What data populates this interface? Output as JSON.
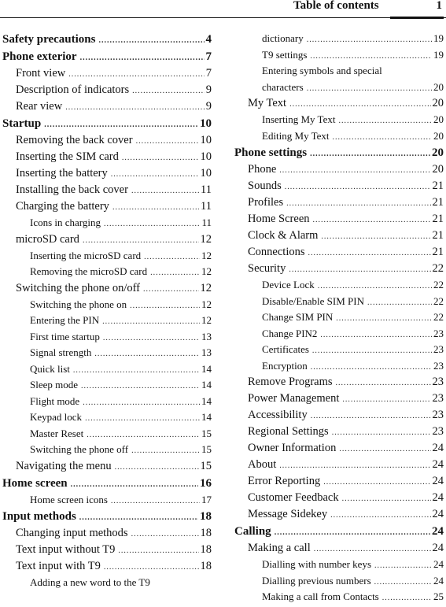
{
  "header": {
    "title": "Table of contents",
    "page": "1"
  },
  "left_column": [
    {
      "level": 1,
      "title": "Safety precautions",
      "page": "4"
    },
    {
      "level": 1,
      "title": "Phone exterior",
      "page": "7"
    },
    {
      "level": 2,
      "title": "Front view",
      "page": "7"
    },
    {
      "level": 2,
      "title": "Description of indicators",
      "page": "9"
    },
    {
      "level": 2,
      "title": "Rear view",
      "page": "9"
    },
    {
      "level": 1,
      "title": "Startup",
      "page": "10"
    },
    {
      "level": 2,
      "title": "Removing the back cover",
      "page": "10"
    },
    {
      "level": 2,
      "title": "Inserting the SIM card",
      "page": "10"
    },
    {
      "level": 2,
      "title": "Inserting the battery",
      "page": "10"
    },
    {
      "level": 2,
      "title": "Installing the back cover",
      "page": "11"
    },
    {
      "level": 2,
      "title": "Charging the battery",
      "page": "11"
    },
    {
      "level": 3,
      "title": "Icons in charging",
      "page": "11"
    },
    {
      "level": 2,
      "title": "microSD card",
      "page": "12"
    },
    {
      "level": 3,
      "title": "Inserting the microSD card",
      "page": "12"
    },
    {
      "level": 3,
      "title": "Removing the microSD card",
      "page": "12"
    },
    {
      "level": 2,
      "title": "Switching the phone on/off",
      "page": "12"
    },
    {
      "level": 3,
      "title": "Switching the phone on",
      "page": "12"
    },
    {
      "level": 3,
      "title": "Entering the PIN",
      "page": "12"
    },
    {
      "level": 3,
      "title": "First time startup",
      "page": "13"
    },
    {
      "level": 3,
      "title": "Signal strength",
      "page": "13"
    },
    {
      "level": 3,
      "title": "Quick list",
      "page": "14"
    },
    {
      "level": 3,
      "title": "Sleep mode",
      "page": "14"
    },
    {
      "level": 3,
      "title": "Flight mode",
      "page": "14"
    },
    {
      "level": 3,
      "title": "Keypad lock",
      "page": "14"
    },
    {
      "level": 3,
      "title": "Master Reset",
      "page": "15"
    },
    {
      "level": 3,
      "title": "Switching the phone off",
      "page": "15"
    },
    {
      "level": 2,
      "title": "Navigating the menu",
      "page": "15"
    },
    {
      "level": 1,
      "title": "Home screen",
      "page": "16"
    },
    {
      "level": 3,
      "title": "Home screen icons",
      "page": "17"
    },
    {
      "level": 1,
      "title": "Input methods",
      "page": "18"
    },
    {
      "level": 2,
      "title": "Changing input methods",
      "page": "18"
    },
    {
      "level": 2,
      "title": "Text input without T9",
      "page": "18"
    },
    {
      "level": 2,
      "title": "Text input with T9",
      "page": "18"
    },
    {
      "level": 3,
      "title": "Adding a new word to the T9",
      "page": "",
      "continued": true
    }
  ],
  "right_column": [
    {
      "level": 3,
      "title": "dictionary",
      "page": "19"
    },
    {
      "level": 3,
      "title": "T9 settings",
      "page": "19"
    },
    {
      "level": 3,
      "title": "Entering symbols and special",
      "page": "",
      "continued": true
    },
    {
      "level": 3,
      "title": "characters",
      "page": "20"
    },
    {
      "level": 2,
      "title": "My Text",
      "page": "20"
    },
    {
      "level": 3,
      "title": "Inserting My Text",
      "page": "20"
    },
    {
      "level": 3,
      "title": "Editing My Text",
      "page": "20"
    },
    {
      "level": 1,
      "title": "Phone settings",
      "page": "20"
    },
    {
      "level": 2,
      "title": "Phone",
      "page": "20"
    },
    {
      "level": 2,
      "title": "Sounds",
      "page": "21"
    },
    {
      "level": 2,
      "title": "Profiles",
      "page": "21"
    },
    {
      "level": 2,
      "title": "Home Screen",
      "page": "21"
    },
    {
      "level": 2,
      "title": "Clock & Alarm",
      "page": "21"
    },
    {
      "level": 2,
      "title": "Connections",
      "page": "21"
    },
    {
      "level": 2,
      "title": "Security",
      "page": "22"
    },
    {
      "level": 3,
      "title": "Device Lock",
      "page": "22"
    },
    {
      "level": 3,
      "title": "Disable/Enable SIM PIN",
      "page": "22"
    },
    {
      "level": 3,
      "title": "Change SIM PIN",
      "page": "22"
    },
    {
      "level": 3,
      "title": "Change PIN2",
      "page": "23"
    },
    {
      "level": 3,
      "title": "Certificates",
      "page": "23"
    },
    {
      "level": 3,
      "title": "Encryption",
      "page": "23"
    },
    {
      "level": 2,
      "title": "Remove Programs",
      "page": "23"
    },
    {
      "level": 2,
      "title": "Power Management",
      "page": "23"
    },
    {
      "level": 2,
      "title": "Accessibility",
      "page": "23"
    },
    {
      "level": 2,
      "title": "Regional Settings",
      "page": "23"
    },
    {
      "level": 2,
      "title": "Owner Information",
      "page": "24"
    },
    {
      "level": 2,
      "title": "About",
      "page": "24"
    },
    {
      "level": 2,
      "title": "Error Reporting",
      "page": "24"
    },
    {
      "level": 2,
      "title": "Customer Feedback",
      "page": "24"
    },
    {
      "level": 2,
      "title": "Message Sidekey",
      "page": "24"
    },
    {
      "level": 1,
      "title": "Calling",
      "page": "24"
    },
    {
      "level": 2,
      "title": "Making a call",
      "page": "24"
    },
    {
      "level": 3,
      "title": "Dialling with number keys",
      "page": "24"
    },
    {
      "level": 3,
      "title": "Dialling previous numbers",
      "page": "24"
    },
    {
      "level": 3,
      "title": "Making a call from Contacts",
      "page": "25"
    }
  ]
}
